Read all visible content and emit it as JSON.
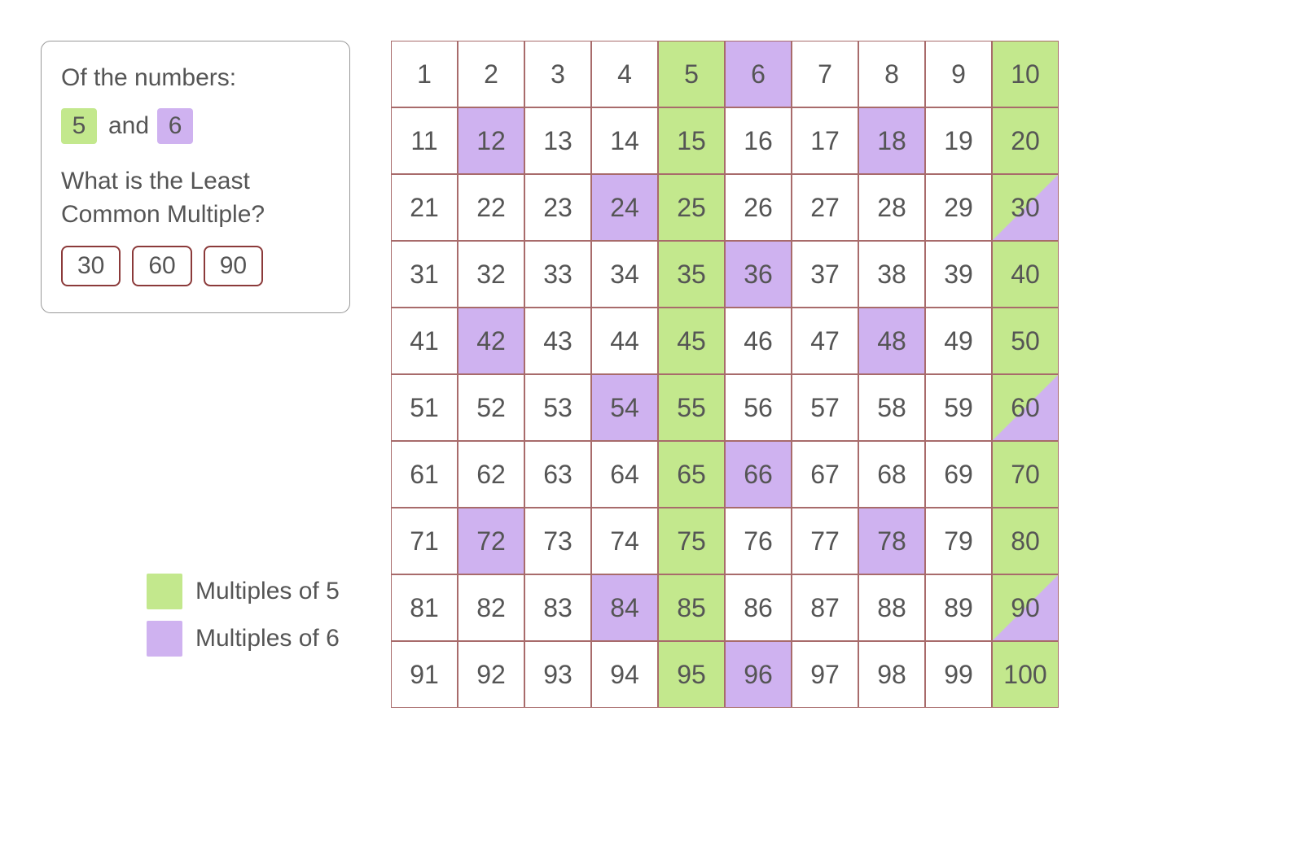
{
  "panel": {
    "intro": "Of the numbers:",
    "first_number": "5",
    "and": "and",
    "second_number": "6",
    "question_l1": "What is the Least",
    "question_l2": "Common Multiple?",
    "options": [
      "30",
      "60",
      "90"
    ]
  },
  "legend": {
    "first": "Multiples of 5",
    "second": "Multiples of 6"
  },
  "grid": {
    "size": 100,
    "mult_a": 5,
    "mult_b": 6
  },
  "colors": {
    "green": "#c3e88d",
    "purple": "#cfb2f0",
    "border_red": "#8b3a3a"
  }
}
